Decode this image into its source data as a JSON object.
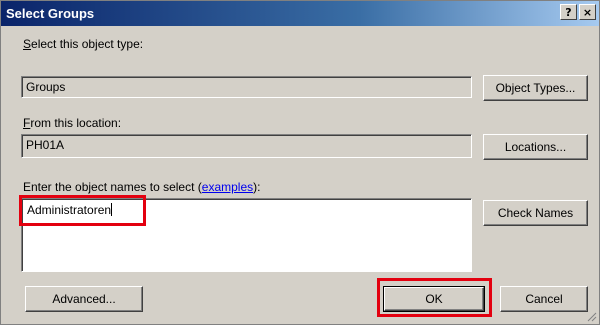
{
  "window": {
    "title": "Select Groups"
  },
  "title_buttons": {
    "help": "?",
    "close": "×"
  },
  "object_type": {
    "label": "Select this object type:",
    "value": "Groups",
    "button": "Object Types..."
  },
  "location": {
    "label": "From this location:",
    "value": "PH01A",
    "button": "Locations..."
  },
  "names": {
    "label_prefix": "Enter the object names to select (",
    "link": "examples",
    "label_suffix": "):",
    "value": "Administratoren",
    "button": "Check Names"
  },
  "footer": {
    "advanced": "Advanced...",
    "ok": "OK",
    "cancel": "Cancel"
  },
  "colors": {
    "highlight": "#e3000f",
    "title_bar": "#0a246a",
    "dialog_bg": "#d4d0c8"
  }
}
